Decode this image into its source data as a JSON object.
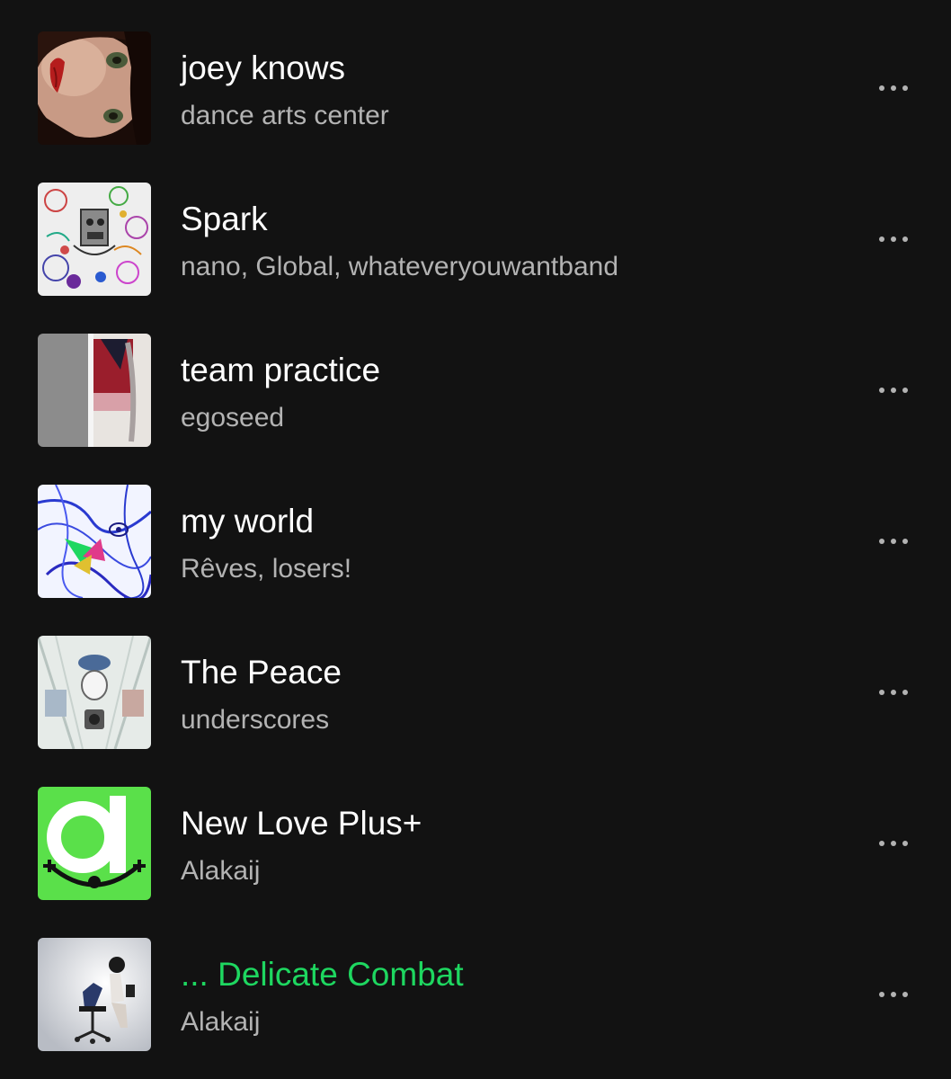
{
  "colors": {
    "background": "#121212",
    "title": "#ffffff",
    "subtitle": "#b3b3b3",
    "playing": "#1ed760"
  },
  "tracks": [
    {
      "title": "joey knows",
      "artist": "dance arts center",
      "playing": false,
      "cover_icon": "album-art-portrait"
    },
    {
      "title": "Spark",
      "artist": "nano, Global, whateveryouwantband",
      "playing": false,
      "cover_icon": "album-art-doodles"
    },
    {
      "title": "team practice",
      "artist": "egoseed",
      "playing": false,
      "cover_icon": "album-art-gray-photo"
    },
    {
      "title": "my world",
      "artist": "Rêves, losers!",
      "playing": false,
      "cover_icon": "album-art-blue-drawing"
    },
    {
      "title": "The Peace",
      "artist": "underscores",
      "playing": false,
      "cover_icon": "album-art-pale-illustration"
    },
    {
      "title": "New Love Plus+",
      "artist": "Alakaij",
      "playing": false,
      "cover_icon": "album-art-green-logo"
    },
    {
      "title": "... Delicate Combat",
      "artist": "Alakaij",
      "playing": true,
      "cover_icon": "album-art-chair-photo"
    }
  ],
  "more_icon": "more-options-icon"
}
